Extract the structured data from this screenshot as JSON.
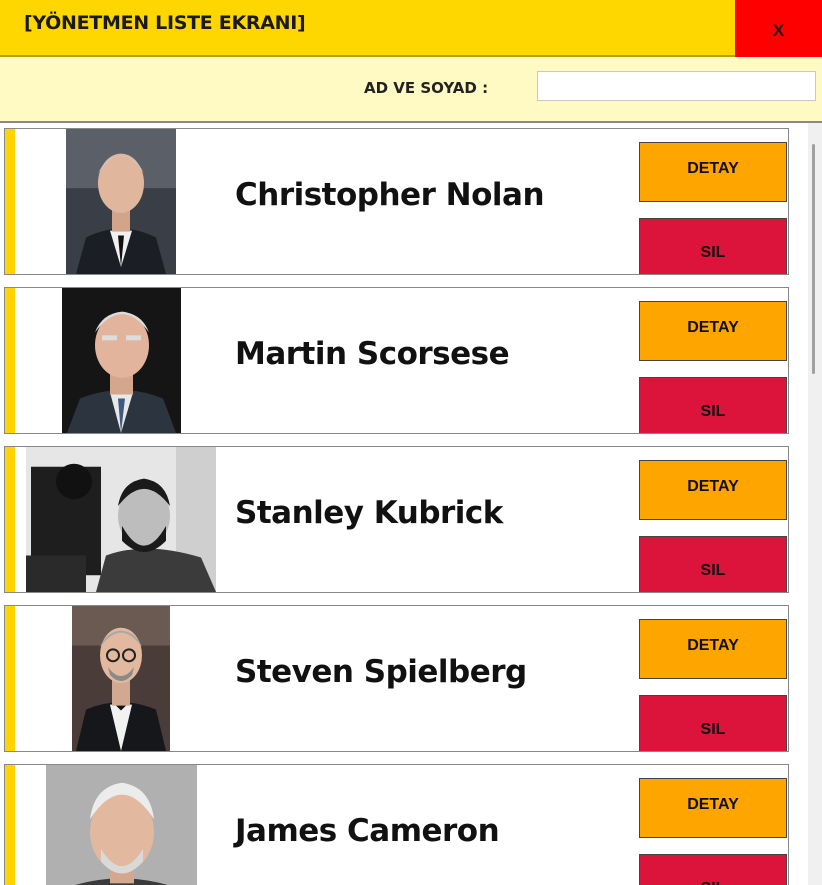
{
  "window": {
    "title": "[YÖNETMEN LISTE EKRANI]",
    "close_label": "X"
  },
  "search": {
    "label": "AD VE SOYAD :",
    "value": "",
    "placeholder": ""
  },
  "directors": [
    {
      "name": "Christopher Nolan",
      "detail_label": "DETAY",
      "delete_label": "SIL"
    },
    {
      "name": "Martin Scorsese",
      "detail_label": "DETAY",
      "delete_label": "SIL"
    },
    {
      "name": "Stanley Kubrick",
      "detail_label": "DETAY",
      "delete_label": "SIL"
    },
    {
      "name": "Steven Spielberg",
      "detail_label": "DETAY",
      "delete_label": "SIL"
    },
    {
      "name": "James Cameron",
      "detail_label": "DETAY",
      "delete_label": "SIL"
    }
  ],
  "colors": {
    "header": "#FFD700",
    "search_bar": "#FFF9C4",
    "close": "#FF0000",
    "detail": "#FFA500",
    "delete": "#DC143C",
    "accent": "#FFD400"
  }
}
